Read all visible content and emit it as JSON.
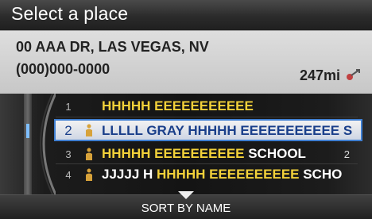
{
  "header": {
    "title": "Select a place"
  },
  "info": {
    "address": "00 AAA DR, LAS VEGAS, NV",
    "phone": "(000)000-0000",
    "distance": "247mi",
    "distance_icon": "route-arrow-icon"
  },
  "list": {
    "items": [
      {
        "number": "1",
        "name_prefix": "",
        "name_highlight": "HHHHH EEEEEEEEEEE",
        "name_suffix": "",
        "count": ""
      },
      {
        "number": "2",
        "name_prefix": "LLLLL GRAY ",
        "name_highlight": "HHHHH EEEEEEEEEEE",
        "name_suffix": " S",
        "count": ""
      },
      {
        "number": "3",
        "name_prefix": "",
        "name_highlight": "HHHHH EEEEEEEEEE",
        "name_suffix": " SCHOOL",
        "count": "2"
      },
      {
        "number": "4",
        "name_prefix": "JJJJJ H ",
        "name_highlight": "HHHHH EEEEEEEEEE",
        "name_suffix": " SCHO",
        "count": ""
      }
    ]
  },
  "footer": {
    "sort_label": "SORT BY NAME"
  },
  "colors": {
    "highlight": "#f2d13a",
    "selection_border": "#3f7fd2"
  }
}
